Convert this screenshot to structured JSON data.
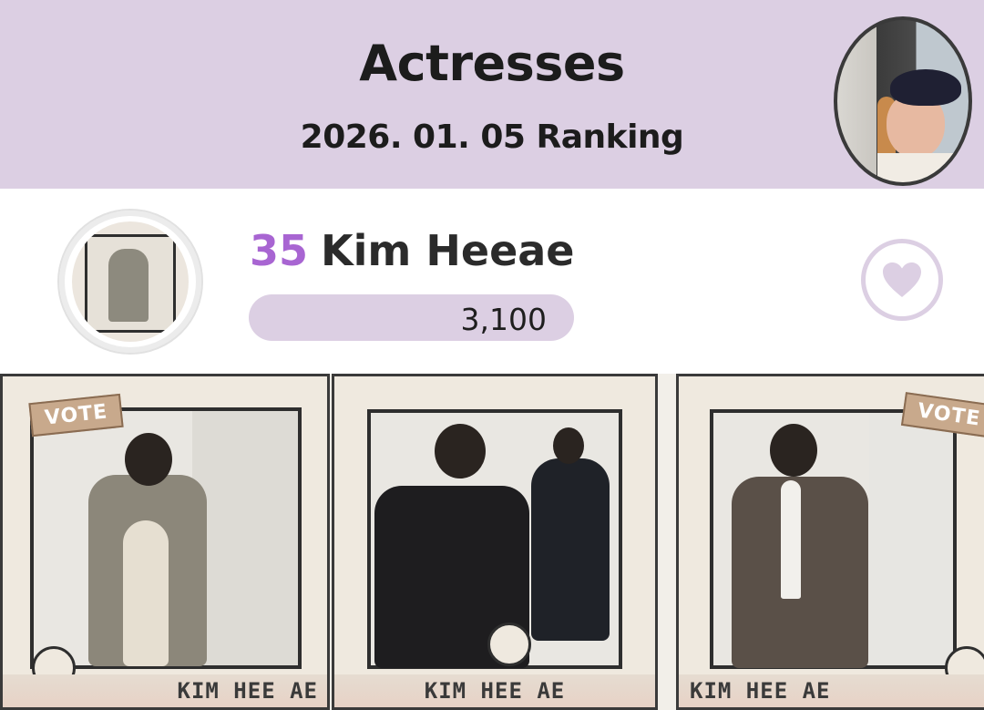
{
  "header": {
    "title": "Actresses",
    "subtitle": "2026. 01. 05 Ranking"
  },
  "entry": {
    "rank": "35",
    "name": "Kim Heeae",
    "votes": "3,100"
  },
  "gallery": [
    {
      "caption": "KIM HEE AE",
      "tag": "VOTE"
    },
    {
      "caption": "KIM HEE AE"
    },
    {
      "caption": "KIM HEE AE",
      "tag": "VOTE"
    }
  ],
  "colors": {
    "accent": "#a865d2",
    "header_bg": "#dccfe3"
  },
  "icons": {
    "heart": "heart-icon"
  }
}
